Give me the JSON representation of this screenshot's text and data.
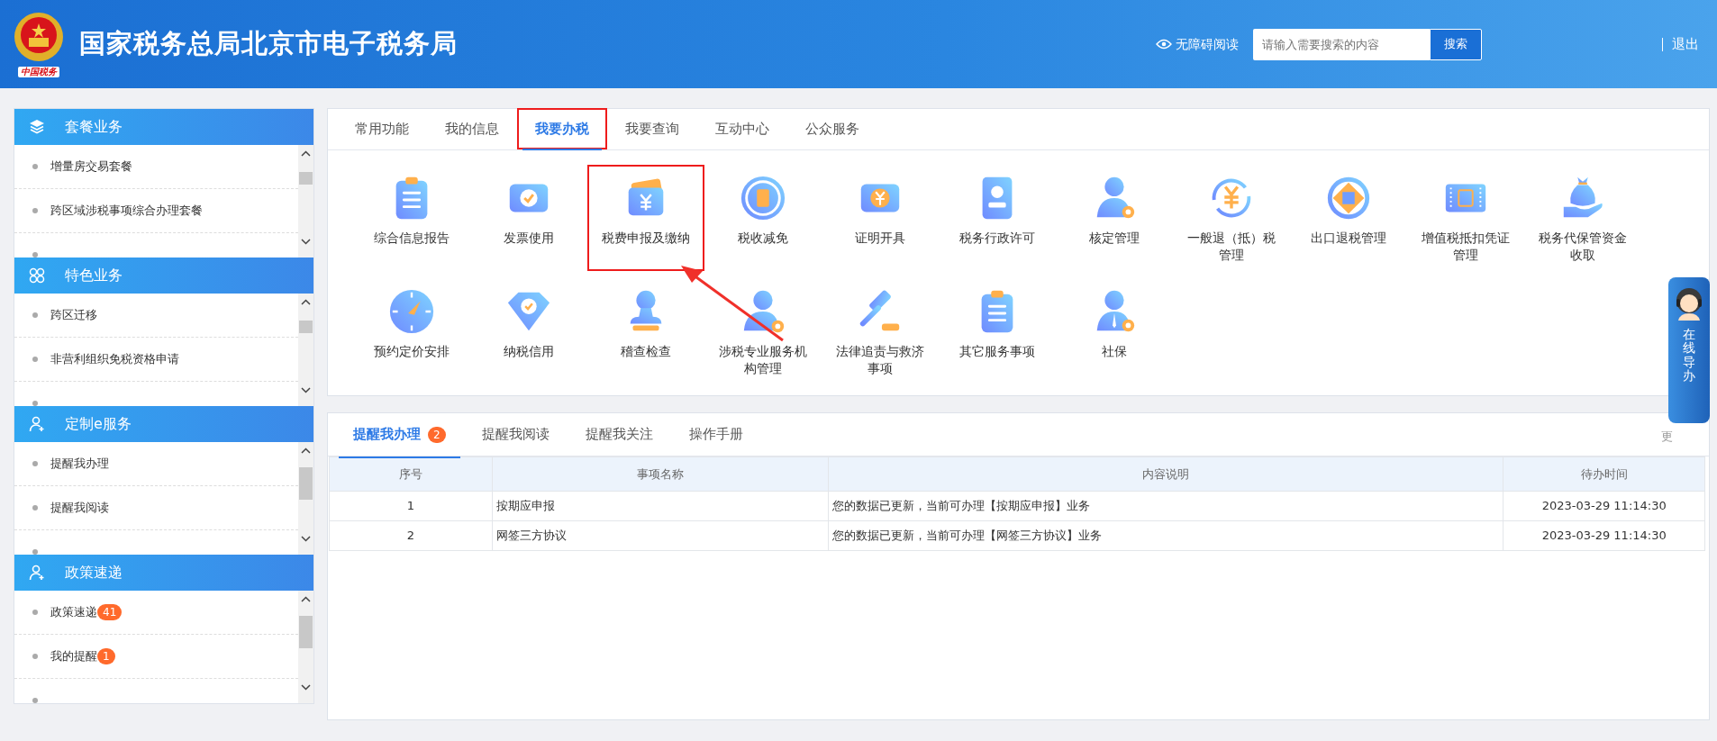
{
  "header": {
    "logo_caption": "中国税务",
    "title": "国家税务总局北京市电子税务局",
    "accessibility": "无障碍阅读",
    "search": {
      "placeholder": "请输入需要搜索的内容",
      "button": "搜索"
    },
    "logout": "退出"
  },
  "sidebar": {
    "sections": [
      {
        "title": "套餐业务",
        "items": [
          {
            "label": "增量房交易套餐"
          },
          {
            "label": "跨区域涉税事项综合办理套餐"
          }
        ]
      },
      {
        "title": "特色业务",
        "items": [
          {
            "label": "跨区迁移"
          },
          {
            "label": "非营利组织免税资格申请"
          }
        ]
      },
      {
        "title": "定制e服务",
        "items": [
          {
            "label": "提醒我办理"
          },
          {
            "label": "提醒我阅读"
          }
        ]
      },
      {
        "title": "政策速递",
        "items": [
          {
            "label": "政策速递",
            "badge": "41"
          },
          {
            "label": "我的提醒",
            "badge": "1"
          }
        ]
      }
    ]
  },
  "services": {
    "tabs": [
      {
        "label": "常用功能",
        "selected": false,
        "highlighted": false
      },
      {
        "label": "我的信息",
        "selected": false,
        "highlighted": false
      },
      {
        "label": "我要办税",
        "selected": true,
        "highlighted": true
      },
      {
        "label": "我要查询",
        "selected": false,
        "highlighted": false
      },
      {
        "label": "互动中心",
        "selected": false,
        "highlighted": false
      },
      {
        "label": "公众服务",
        "selected": false,
        "highlighted": false
      }
    ],
    "items": [
      {
        "label": "综合信息报告",
        "highlighted": false
      },
      {
        "label": "发票使用",
        "highlighted": false
      },
      {
        "label": "税费申报及缴纳",
        "highlighted": true
      },
      {
        "label": "税收减免",
        "highlighted": false
      },
      {
        "label": "证明开具",
        "highlighted": false
      },
      {
        "label": "税务行政许可",
        "highlighted": false
      },
      {
        "label": "核定管理",
        "highlighted": false
      },
      {
        "label": "一般退（抵）税管理",
        "highlighted": false
      },
      {
        "label": "出口退税管理",
        "highlighted": false
      },
      {
        "label": "增值税抵扣凭证管理",
        "highlighted": false
      },
      {
        "label": "税务代保管资金收取",
        "highlighted": false
      },
      {
        "label": "预约定价安排",
        "highlighted": false
      },
      {
        "label": "纳税信用",
        "highlighted": false
      },
      {
        "label": "稽查检查",
        "highlighted": false
      },
      {
        "label": "涉税专业服务机构管理",
        "highlighted": false
      },
      {
        "label": "法律追责与救济事项",
        "highlighted": false
      },
      {
        "label": "其它服务事项",
        "highlighted": false
      },
      {
        "label": "社保",
        "highlighted": false
      }
    ],
    "annotation_arrow": true
  },
  "reminders": {
    "tabs": [
      {
        "label": "提醒我办理",
        "selected": true,
        "badge": "2"
      },
      {
        "label": "提醒我阅读",
        "selected": false
      },
      {
        "label": "提醒我关注",
        "selected": false
      },
      {
        "label": "操作手册",
        "selected": false
      }
    ],
    "more": "更",
    "table": {
      "columns": [
        "序号",
        "事项名称",
        "内容说明",
        "待办时间"
      ],
      "rows": [
        [
          "1",
          "按期应申报",
          "您的数据已更新，当前可办理【按期应申报】业务",
          "2023-03-29 11:14:30"
        ],
        [
          "2",
          "网签三方协议",
          "您的数据已更新，当前可办理【网签三方协议】业务",
          "2023-03-29 11:14:30"
        ]
      ]
    }
  },
  "assistant": {
    "label": "在线导办"
  }
}
